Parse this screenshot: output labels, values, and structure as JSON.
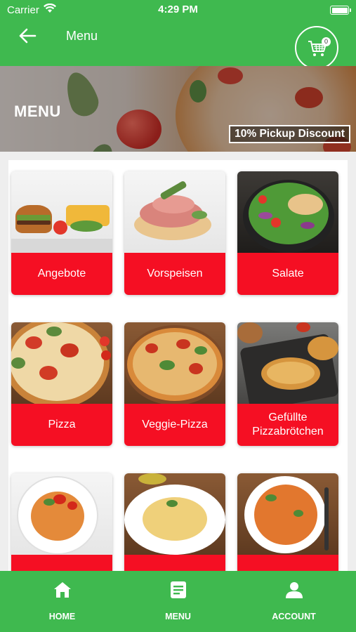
{
  "status_bar": {
    "carrier": "Carrier",
    "time": "4:29 PM"
  },
  "header": {
    "title": "Menu",
    "cart_count": "0"
  },
  "banner": {
    "title": "MENU",
    "badge": "10% Pickup Discount"
  },
  "categories": [
    {
      "label": "Angebote"
    },
    {
      "label": "Vorspeisen"
    },
    {
      "label": "Salate"
    },
    {
      "label": "Pizza"
    },
    {
      "label": "Veggie-Pizza"
    },
    {
      "label": "Gefüllte Pizzabrötchen"
    },
    {
      "label": ""
    },
    {
      "label": ""
    },
    {
      "label": ""
    }
  ],
  "bottom_nav": {
    "home": "HOME",
    "menu": "MENU",
    "account": "ACCOUNT"
  },
  "colors": {
    "primary_green": "#3fb94f",
    "category_red": "#f50f23"
  },
  "icons": [
    "back-arrow-icon",
    "cart-icon",
    "home-icon",
    "menu-list-icon",
    "account-icon",
    "wifi-icon",
    "battery-icon"
  ]
}
